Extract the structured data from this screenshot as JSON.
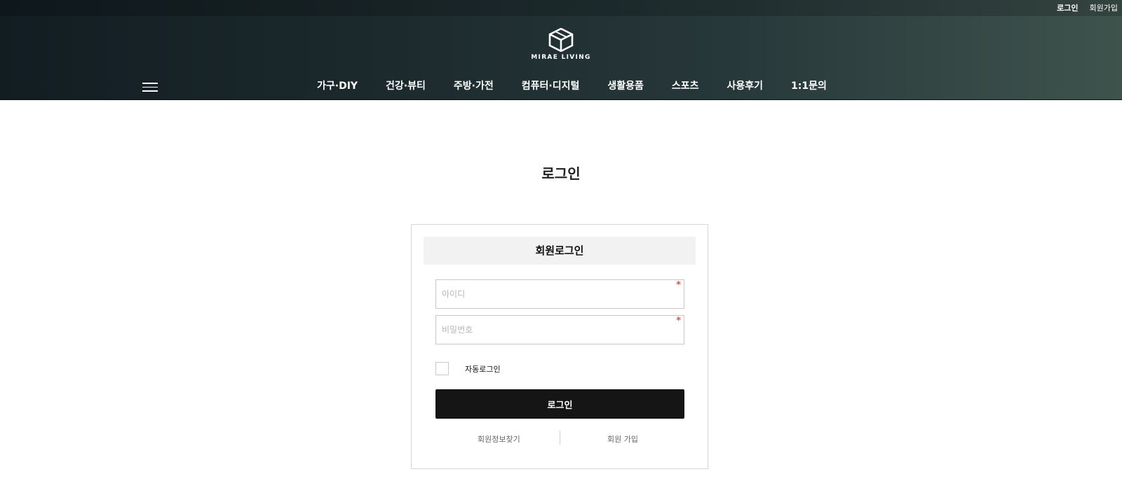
{
  "topbar": {
    "login": "로그인",
    "join": "회원가입"
  },
  "logo": {
    "text": "MIRAE LIVING",
    "icon": "mirae-living-logo-icon"
  },
  "nav": {
    "menu_icon": "hamburger-icon",
    "items": [
      "가구·DIY",
      "건강·뷰티",
      "주방·가전",
      "컴퓨터·디지털",
      "생활용품",
      "스포츠",
      "사용후기",
      "1:1문의"
    ]
  },
  "page": {
    "title": "로그인"
  },
  "login_box": {
    "title": "회원로그인",
    "id_placeholder": "아이디",
    "pw_placeholder": "비밀번호",
    "required_mark": "*",
    "auto_login_label": "자동로그인",
    "login_button": "로그인",
    "find_info_link": "회원정보찾기",
    "join_link": "회원 가입"
  },
  "colors": {
    "header_gradient_start": "#121d22",
    "header_gradient_end": "#3f534d",
    "button_bg": "#151515",
    "required_mark": "#d9534f",
    "box_title_bg": "#f2f2f2"
  }
}
